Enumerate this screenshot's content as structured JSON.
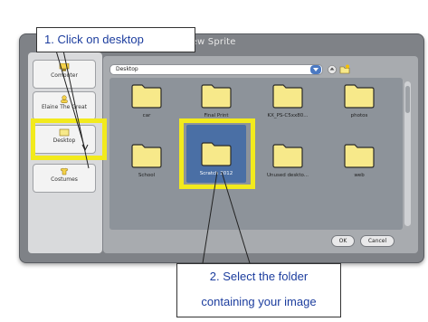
{
  "dialog": {
    "title": "New Sprite",
    "locations": [
      {
        "label": "Computer",
        "icon": "computer-icon"
      },
      {
        "label": "Elaine The Great",
        "icon": "user-icon"
      },
      {
        "label": "Desktop",
        "icon": "desktop-icon"
      },
      {
        "label": "Costumes",
        "icon": "costumes-icon"
      }
    ],
    "path": "Desktop",
    "folders": [
      {
        "name": "car"
      },
      {
        "name": "Final Print"
      },
      {
        "name": "KX_PS-C5xx80..."
      },
      {
        "name": "photos"
      },
      {
        "name": "School"
      },
      {
        "name": "Scratch 2012"
      },
      {
        "name": "Unused deskto..."
      },
      {
        "name": "web"
      }
    ],
    "selected_folder": "Scratch 2012",
    "buttons": {
      "ok": "OK",
      "cancel": "Cancel"
    }
  },
  "annotations": {
    "step1": "1. Click on desktop",
    "step2_line1": "2. Select the folder",
    "step2_line2": "containing your image"
  },
  "colors": {
    "highlight": "#f2ea1d",
    "selection": "#4a6fa5",
    "folder": "#f7e98a",
    "annotation_text": "#1c3d9e"
  }
}
